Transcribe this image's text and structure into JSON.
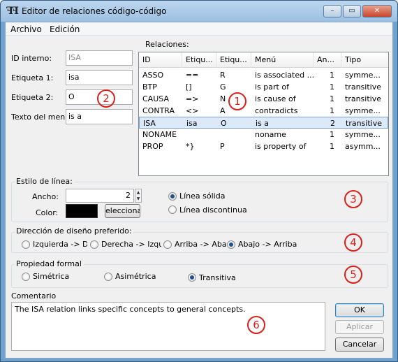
{
  "window": {
    "title": "Editor de relaciones código-código",
    "icon": "double-hook-icon",
    "controls": [
      "–",
      "▭",
      "✕"
    ]
  },
  "menu": [
    "Archivo",
    "Edición"
  ],
  "fields": {
    "id_label": "ID interno:",
    "id_value": "ISA",
    "label1_label": "Etiqueta 1:",
    "label1_value": "isa",
    "label2_label": "Etiqueta 2:",
    "label2_value": "O",
    "menu_text_label": "Texto del menú",
    "menu_text_value": "is a"
  },
  "relations": {
    "title": "Relaciones:",
    "columns": [
      "ID",
      "Etiqu...",
      "Etiqu...",
      "Menú",
      "An...",
      "Tipo"
    ],
    "rows": [
      [
        "ASSO",
        "==",
        "R",
        "is associated ...",
        "1",
        "symme..."
      ],
      [
        "BTP",
        "[]",
        "G",
        "is part of",
        "1",
        "transitive"
      ],
      [
        "CAUSA",
        "=>",
        "N",
        "is cause of",
        "1",
        "transitive"
      ],
      [
        "CONTRA",
        "<>",
        "A",
        "contradicts",
        "1",
        "symme..."
      ],
      [
        "ISA",
        "isa",
        "O",
        "is a",
        "2",
        "transitive"
      ],
      [
        "NONAME",
        "",
        "",
        "noname",
        "1",
        "symme..."
      ],
      [
        "PROP",
        "*}",
        "P",
        "is property of",
        "1",
        "asymm..."
      ]
    ],
    "selected_index": 4
  },
  "line_style": {
    "title": "Estilo de línea:",
    "width_label": "Ancho:",
    "width_value": "2",
    "color_label": "Color:",
    "color_value": "#000000",
    "select_button": "elecciona",
    "solid_label": "Línea sólida",
    "dashed_label": "Línea discontinua",
    "selected": "solid"
  },
  "direction": {
    "title": "Dirección de diseño preferido:",
    "options": [
      "Izquierda -> De",
      "Derecha -> Izquie",
      "Arriba -> Abajo",
      "Abajo -> Arriba"
    ],
    "selected_index": 3
  },
  "formal": {
    "title": "Propiedad formal",
    "options": [
      "Simétrica",
      "Asimétrica",
      "Transitiva"
    ],
    "selected_index": 2
  },
  "comment": {
    "title": "Comentario",
    "text": "The ISA relation links specific concepts to general concepts."
  },
  "buttons": {
    "ok": "OK",
    "apply": "Aplicar",
    "cancel": "Cancelar"
  },
  "callouts": [
    "1",
    "2",
    "3",
    "4",
    "5",
    "6"
  ],
  "accent_color": "#d9211a"
}
